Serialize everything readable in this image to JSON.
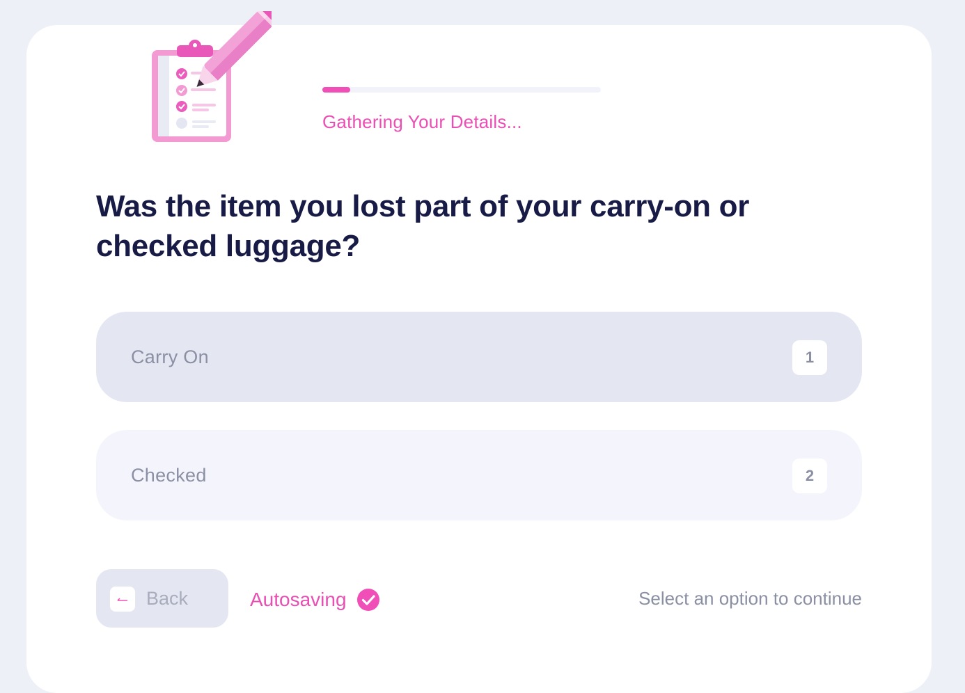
{
  "header": {
    "progress_fraction": 0.1,
    "progress_label": "Gathering Your Details..."
  },
  "question": {
    "text": "Was the item you lost part of your carry-on or checked luggage?"
  },
  "options": [
    {
      "label": "Carry On",
      "key": "1"
    },
    {
      "label": "Checked",
      "key": "2"
    }
  ],
  "footer": {
    "back_label": "Back",
    "autosave_label": "Autosaving",
    "hint": "Select an option to continue"
  },
  "icons": {
    "illustration": "clipboard-pencil-icon",
    "back": "back-arrow-icon",
    "autosave": "check-circle-icon"
  },
  "colors": {
    "accent": "#ef4fb6",
    "heading": "#171b45",
    "muted": "#8b8fa4",
    "option_bg": "#e4e7f2"
  }
}
